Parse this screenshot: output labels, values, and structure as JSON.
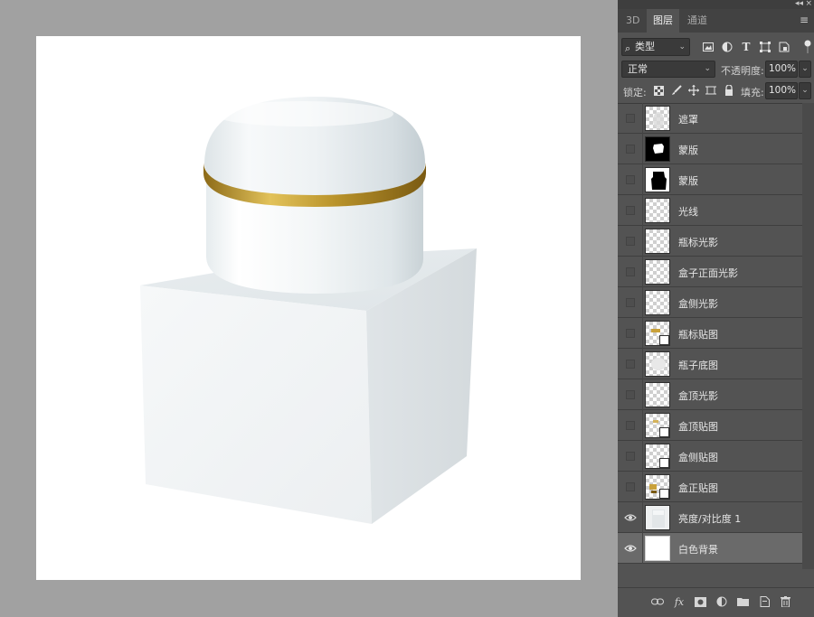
{
  "panel": {
    "tabs": [
      {
        "label": "3D"
      },
      {
        "label": "图层"
      },
      {
        "label": "通道"
      }
    ],
    "active_tab": "图层",
    "filter": {
      "kind_label": "类型",
      "icons": [
        "image-filter-icon",
        "adjustment-filter-icon",
        "type-filter-icon",
        "shape-filter-icon",
        "smart-object-filter-icon"
      ]
    },
    "blend_mode": "正常",
    "opacity_label": "不透明度:",
    "opacity_value": "100%",
    "lock_label": "锁定:",
    "fill_label": "填充:",
    "fill_value": "100%",
    "layers": [
      {
        "name": "遮罩",
        "visible": false,
        "thumb": "transparent-shape"
      },
      {
        "name": "蒙版",
        "visible": false,
        "thumb": "black-mask-1"
      },
      {
        "name": "蒙版",
        "visible": false,
        "thumb": "black-mask-2"
      },
      {
        "name": "光线",
        "visible": false,
        "thumb": "transparent"
      },
      {
        "name": "瓶标光影",
        "visible": false,
        "thumb": "transparent"
      },
      {
        "name": "盒子正面光影",
        "visible": false,
        "thumb": "transparent"
      },
      {
        "name": "盒侧光影",
        "visible": false,
        "thumb": "transparent"
      },
      {
        "name": "瓶标贴图",
        "visible": false,
        "thumb": "smart-object"
      },
      {
        "name": "瓶子底图",
        "visible": false,
        "thumb": "transparent-shape"
      },
      {
        "name": "盒顶光影",
        "visible": false,
        "thumb": "transparent"
      },
      {
        "name": "盒顶贴图",
        "visible": false,
        "thumb": "smart-object"
      },
      {
        "name": "盒侧贴图",
        "visible": false,
        "thumb": "smart-object"
      },
      {
        "name": "盒正贴图",
        "visible": false,
        "thumb": "smart-object"
      },
      {
        "name": "亮度/对比度 1",
        "visible": true,
        "thumb": "adjustment"
      },
      {
        "name": "白色背景",
        "visible": true,
        "thumb": "white",
        "selected": true
      }
    ]
  },
  "colors": {
    "gold_band": "#b8922a",
    "panel_bg": "#535353",
    "workspace_bg": "#a1a1a1"
  }
}
